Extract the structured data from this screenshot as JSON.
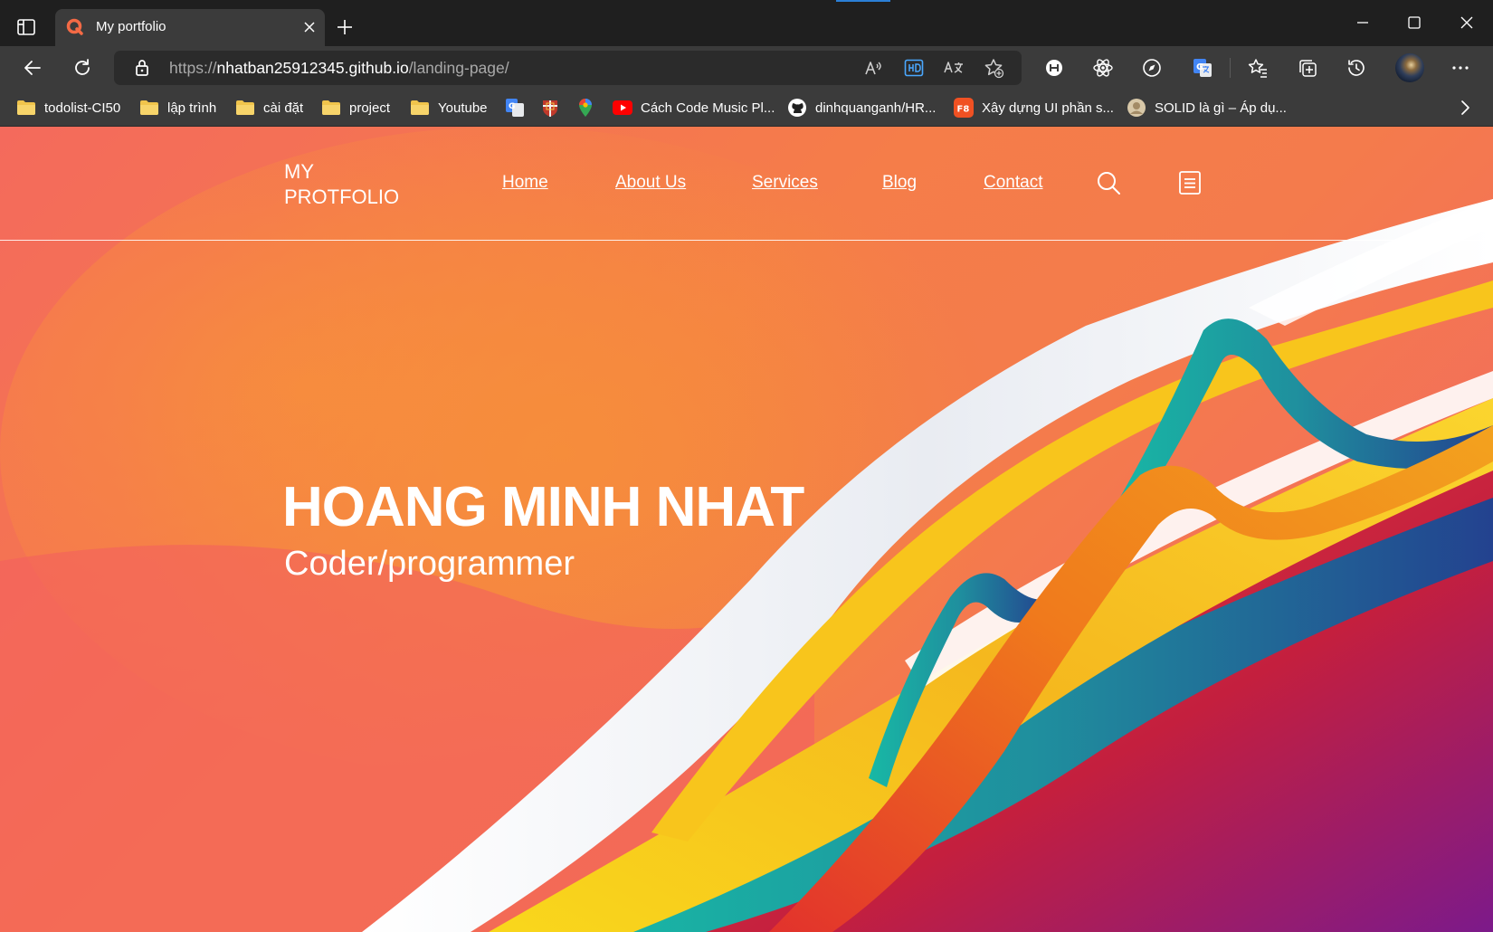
{
  "browser": {
    "tab_title": "My portfolio",
    "url": {
      "scheme": "https://",
      "host": "nhatban25912345.github.io",
      "path": "/landing-page/"
    },
    "bookmarks": [
      {
        "label": "todolist-CI50",
        "icon": "folder-icon"
      },
      {
        "label": "lập trình",
        "icon": "folder-icon"
      },
      {
        "label": "cài đặt",
        "icon": "folder-icon"
      },
      {
        "label": "project",
        "icon": "folder-icon"
      },
      {
        "label": "Youtube",
        "icon": "folder-icon"
      },
      {
        "label": "",
        "icon": "google-translate-icon"
      },
      {
        "label": "",
        "icon": "university-crest-icon"
      },
      {
        "label": "",
        "icon": "google-maps-icon"
      },
      {
        "label": "Cách Code Music Pl...",
        "icon": "youtube-icon"
      },
      {
        "label": "dinhquanganh/HR...",
        "icon": "github-icon"
      },
      {
        "label": "Xây dựng UI phần s...",
        "icon": "f8-icon"
      },
      {
        "label": "SOLID là gì – Áp dụ...",
        "icon": "site-avatar-icon"
      }
    ],
    "f8_badge": "F8",
    "colors": {
      "titlebar": "#1f1f1f",
      "toolbar": "#3b3b3b",
      "addressbar": "#2b2b2b",
      "accent": "#2b7fd6"
    }
  },
  "site": {
    "logo_line1": "MY",
    "logo_line2": "PROTFOLIO",
    "nav": [
      "Home",
      "About Us",
      "Services",
      "Blog",
      "Contact"
    ],
    "hero_name": "HOANG MINH NHAT",
    "hero_role": "Coder/programmer",
    "colors": {
      "hero_orange": "#f57d49",
      "hero_coral": "#f46a5c",
      "text": "#ffffff"
    }
  }
}
